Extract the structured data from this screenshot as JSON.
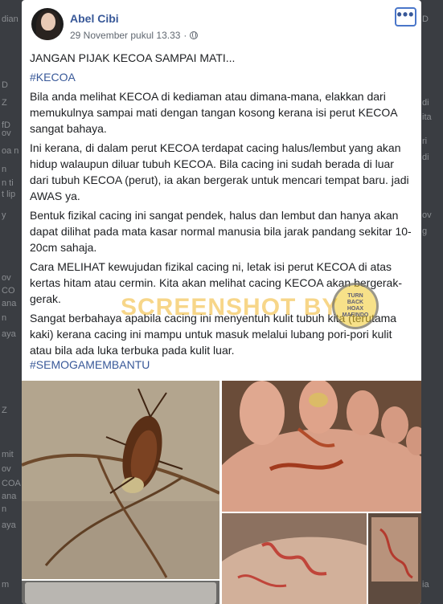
{
  "background": {
    "left_fragments": [
      "dian",
      "D",
      "Z",
      "fD",
      "ov",
      "oa n",
      "n",
      "n ti",
      "t lip",
      "y",
      "ov",
      "CO",
      "ana",
      "n",
      "aya",
      "Z",
      "mit",
      "ov",
      "COA",
      "ana",
      "n",
      "aya",
      "m"
    ],
    "right_fragments": [
      "D",
      "di",
      "ita",
      "ri",
      "di",
      "ov",
      "g",
      "ia"
    ]
  },
  "post": {
    "author": "Abel Cibi",
    "timestamp": "29 November pukul 13.33",
    "separator": "·",
    "more_icon": "more-horizontal-icon",
    "title_line": "JANGAN PIJAK KECOA SAMPAI MATI...",
    "hashtag_1": "#KECOA",
    "paragraphs": [
      "Bila anda melihat KECOA di kediaman atau dimana-mana, elakkan dari memukulnya sampai mati dengan tangan kosong kerana isi perut KECOA sangat bahaya.",
      "Ini kerana, di dalam perut KECOA terdapat cacing halus/lembut yang akan hidup walaupun diluar tubuh KECOA. Bila cacing ini sudah berada di luar dari tubuh KECOA (perut), ia akan bergerak untuk mencari tempat baru. jadi AWAS ya.",
      "Bentuk fizikal cacing ini sangat pendek, halus dan lembut dan hanya akan dapat dilihat pada mata kasar normal manusia bila jarak pandang sekitar 10-20cm sahaja.",
      "Cara MELIHAT kewujudan fizikal cacing ni, letak isi perut KECOA di atas kertas hitam atau cermin. Kita akan melihat cacing KECOA akan bergerak-gerak.",
      "Sangat berbahaya apabila cacing ini menyentuh kulit tubuh kita (terutama kaki) kerana cacing ini mampu untuk masuk melalui lubang pori-pori kulit atau bila ada luka terbuka pada kulit luar."
    ],
    "hashtag_2": "#SEMOGAMEMBANTU"
  },
  "watermark": {
    "text": "SCREENSHOT BY",
    "badge_lines": [
      "TURN",
      "BACK",
      "HOAX",
      "MAFINDO"
    ]
  },
  "colors": {
    "link": "#385898",
    "text": "#1c1e21",
    "muted": "#606770",
    "backdrop": "#2b2e33"
  }
}
